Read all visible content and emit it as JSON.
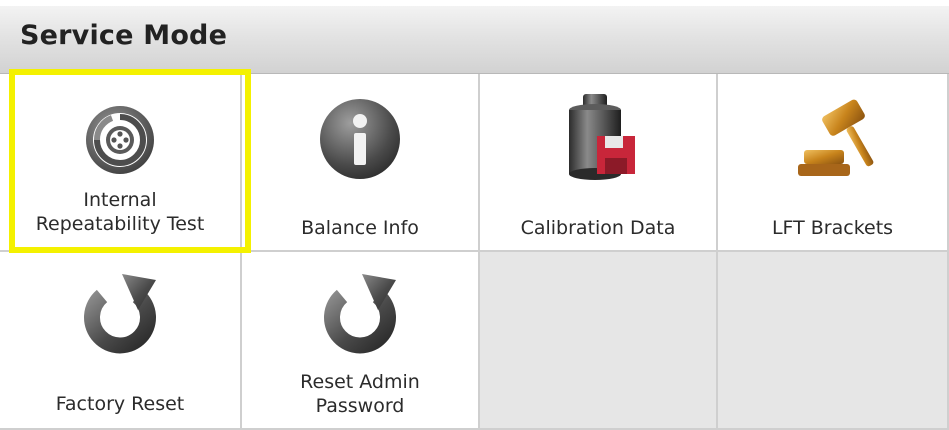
{
  "header": {
    "title": "Service Mode"
  },
  "tiles": [
    {
      "label": "Internal\nRepeatability Test",
      "icon": "target-icon",
      "highlighted": true
    },
    {
      "label": "Balance Info",
      "icon": "info-icon"
    },
    {
      "label": "Calibration Data",
      "icon": "calibration-weight-icon"
    },
    {
      "label": "LFT Brackets",
      "icon": "gavel-icon"
    },
    {
      "label": "Factory Reset",
      "icon": "reset-arrow-icon"
    },
    {
      "label": "Reset Admin\nPassword",
      "icon": "reset-arrow-icon"
    }
  ],
  "colors": {
    "highlight": "#f4f100",
    "empty_tile": "#e6e6e6",
    "icon_dark": "#4a4a4a",
    "calibration_red": "#c8263a",
    "gavel_gold": "#c8841c"
  }
}
